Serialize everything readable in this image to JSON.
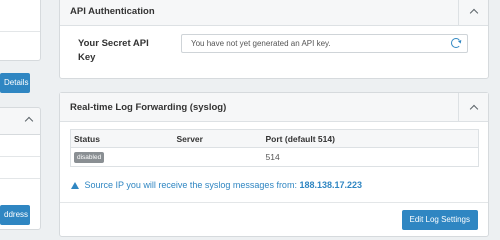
{
  "left": {
    "details_button": "Details",
    "address_button": "ddress"
  },
  "api_auth": {
    "title": "API Authentication",
    "field_label": "Your Secret API Key",
    "field_value": "You have not yet generated an API key."
  },
  "log_forwarding": {
    "title": "Real-time Log Forwarding (syslog)",
    "columns": [
      "Status",
      "Server",
      "Port (default 514)"
    ],
    "rows": [
      {
        "status": "disabled",
        "server": "",
        "port": "514"
      }
    ],
    "info_prefix": "Source IP you will receive the syslog messages from:",
    "info_ip": "188.138.17.223",
    "edit_button": "Edit Log Settings"
  },
  "colors": {
    "accent": "#2f86c2",
    "badge": "#8a8f93",
    "background": "#edf0f2"
  },
  "icons": [
    "chevron-up-icon",
    "refresh-icon",
    "warning-icon"
  ]
}
